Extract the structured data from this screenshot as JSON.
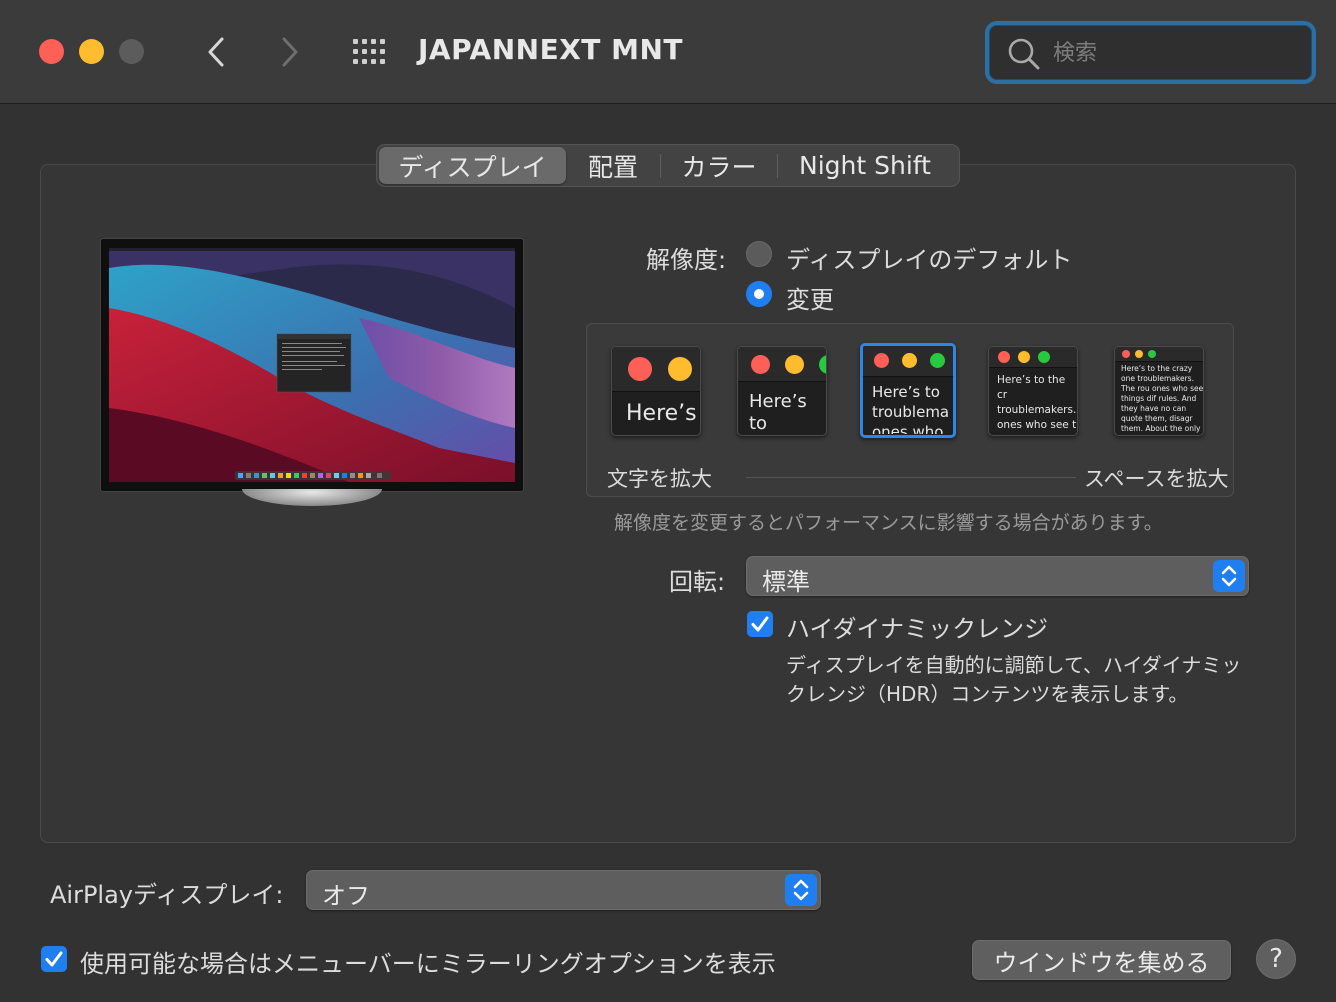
{
  "window": {
    "title": "JAPANNEXT MNT",
    "search_placeholder": "検索"
  },
  "tabs": [
    {
      "label": "ディスプレイ",
      "active": true
    },
    {
      "label": "配置",
      "active": false
    },
    {
      "label": "カラー",
      "active": false
    },
    {
      "label": "Night Shift",
      "active": false
    }
  ],
  "resolution": {
    "label": "解像度:",
    "options": [
      {
        "label": "ディスプレイのデフォルト",
        "selected": false
      },
      {
        "label": "変更",
        "selected": true
      }
    ],
    "thumbnails": [
      {
        "text": "Here’s"
      },
      {
        "text": "Here’s to troublem"
      },
      {
        "text": "Here’s to troublema ones who"
      },
      {
        "text": "Here’s to the cr troublemakers. ones who see t rules. And they"
      },
      {
        "text": "Here’s to the crazy one troublemakers. The rou ones who see things dif rules. And they have no can quote them, disagr them. About the only th Because they change th"
      }
    ],
    "selected_index": 2,
    "scale_left": "文字を拡大",
    "scale_right": "スペースを拡大",
    "note": "解像度を変更するとパフォーマンスに影響する場合があります。"
  },
  "rotation": {
    "label": "回転:",
    "value": "標準"
  },
  "hdr": {
    "label": "ハイダイナミックレンジ",
    "checked": true,
    "description_line1": "ディスプレイを自動的に調節して、ハイダイナミッ",
    "description_line2": "クレンジ（HDR）コンテンツを表示します。"
  },
  "airplay": {
    "label": "AirPlayディスプレイ:",
    "value": "オフ"
  },
  "mirror_option": {
    "label": "使用可能な場合はメニューバーにミラーリングオプションを表示",
    "checked": true
  },
  "buttons": {
    "gather_windows": "ウインドウを集める",
    "help": "?"
  },
  "colors": {
    "accent": "#1f7ff0",
    "close": "#fe5f57",
    "minimize": "#febc2e",
    "zoom_disabled": "#5c5c5c"
  }
}
